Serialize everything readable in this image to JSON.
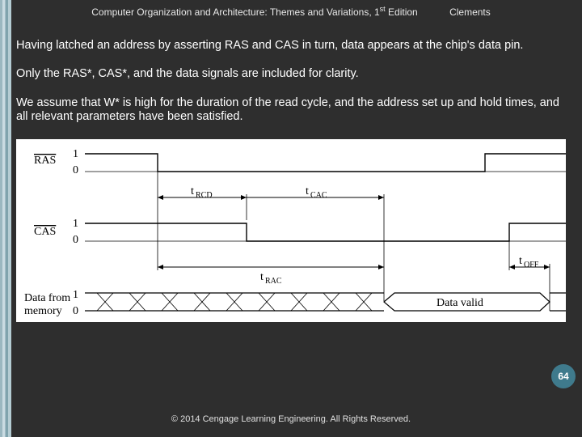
{
  "header": {
    "title_pre": "Computer Organization and Architecture: Themes and Variations, 1",
    "title_sup": "st",
    "title_post": " Edition",
    "author": "Clements"
  },
  "paragraphs": {
    "p1": "Having latched an address by asserting RAS and CAS in turn, data appears at the chip's data pin.",
    "p2": "Only the RAS*, CAS*, and the data signals are included  for clarity.",
    "p3": "We assume that W* is high for the duration of the read cycle, and the address set up and hold times, and all relevant parameters have been satisfied."
  },
  "diagram": {
    "signals": {
      "ras": {
        "label": "RAS",
        "level_hi": "1",
        "level_lo": "0"
      },
      "cas": {
        "label": "CAS",
        "level_hi": "1",
        "level_lo": "0"
      },
      "data": {
        "label": "Data from\nmemory",
        "level_hi": "1",
        "level_lo": "0"
      }
    },
    "timings": {
      "t_rcd": "RCD",
      "t_cac": "CAC",
      "t_rac": "RAC",
      "t_off": "OFF",
      "t_prefix": "t"
    },
    "data_valid": "Data valid"
  },
  "footer": {
    "copyright": "© 2014 Cengage Learning Engineering. All Rights Reserved."
  },
  "page_number": "64"
}
